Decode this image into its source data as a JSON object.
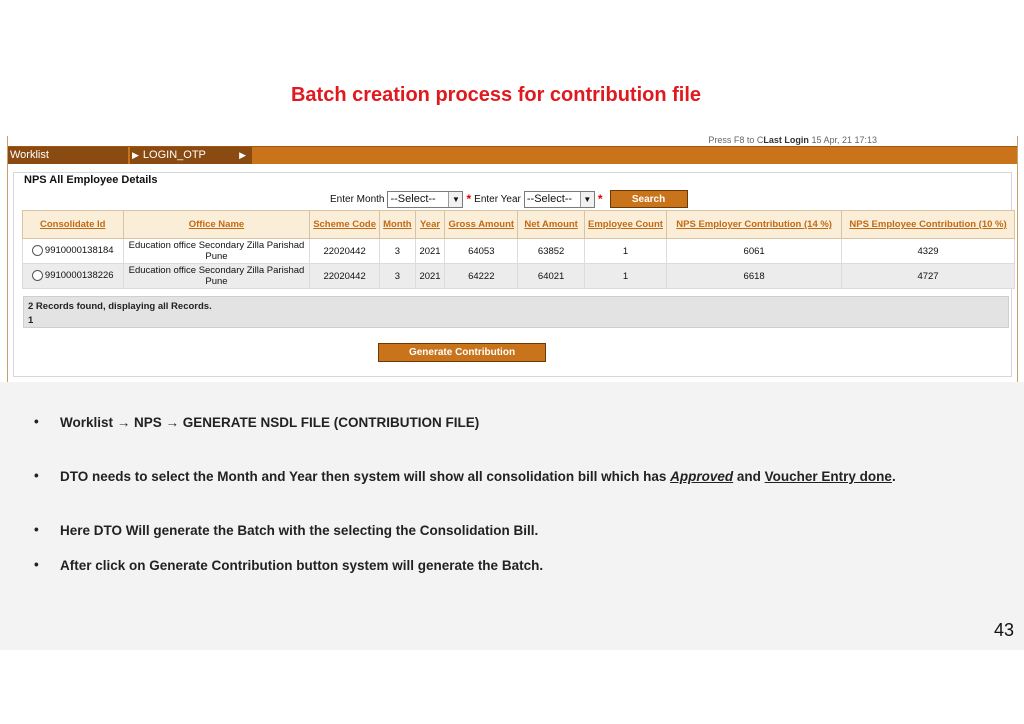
{
  "slide": {
    "title": "Batch creation process for contribution file",
    "page_number": "43"
  },
  "app": {
    "last_login_prefix": "Press F8 to C",
    "last_login_label": "Last Login",
    "last_login_value": "15 Apr, 21 17:13",
    "menu": [
      {
        "label": "Worklist"
      },
      {
        "label": "LOGIN_OTP"
      }
    ],
    "panel_title": "NPS All Employee Details",
    "filters": {
      "month_label": "Enter Month",
      "month_value": "--Select--",
      "year_label": "Enter Year",
      "year_value": "--Select--",
      "search_label": "Search"
    },
    "table": {
      "headers": [
        "Consolidate Id",
        "Office Name",
        "Scheme Code",
        "Month",
        "Year",
        "Gross Amount",
        "Net Amount",
        "Employee Count",
        "NPS Employer Contribution (14 %)",
        "NPS Employee Contribution (10 %)"
      ],
      "rows": [
        {
          "consolidate_id": "9910000138184",
          "office_name": "Education office Secondary Zilla Parishad Pune",
          "scheme_code": "22020442",
          "month": "3",
          "year": "2021",
          "gross_amount": "64053",
          "net_amount": "63852",
          "employee_count": "1",
          "employer_contribution": "6061",
          "employee_contribution": "4329"
        },
        {
          "consolidate_id": "9910000138226",
          "office_name": "Education office Secondary Zilla Parishad Pune",
          "scheme_code": "22020442",
          "month": "3",
          "year": "2021",
          "gross_amount": "64222",
          "net_amount": "64021",
          "employee_count": "1",
          "employer_contribution": "6618",
          "employee_contribution": "4727"
        }
      ]
    },
    "records_text": "2 Records found, displaying all Records.",
    "pagination_page": "1",
    "generate_label": "Generate Contribution"
  },
  "bullets": {
    "b1": "Worklist → NPS → GENERATE NSDL FILE (CONTRIBUTION FILE)",
    "b2_part1": "DTO needs to select the Month and Year then system will show all consolidation bill which has ",
    "b2_approved": "Approved",
    "b2_and": " and ",
    "b2_voucher": "Voucher Entry done",
    "b2_end": ".",
    "b3": "Here DTO Will generate the Batch with the selecting the Consolidation Bill.",
    "b4": "After click on Generate Contribution button system will generate the Batch."
  }
}
